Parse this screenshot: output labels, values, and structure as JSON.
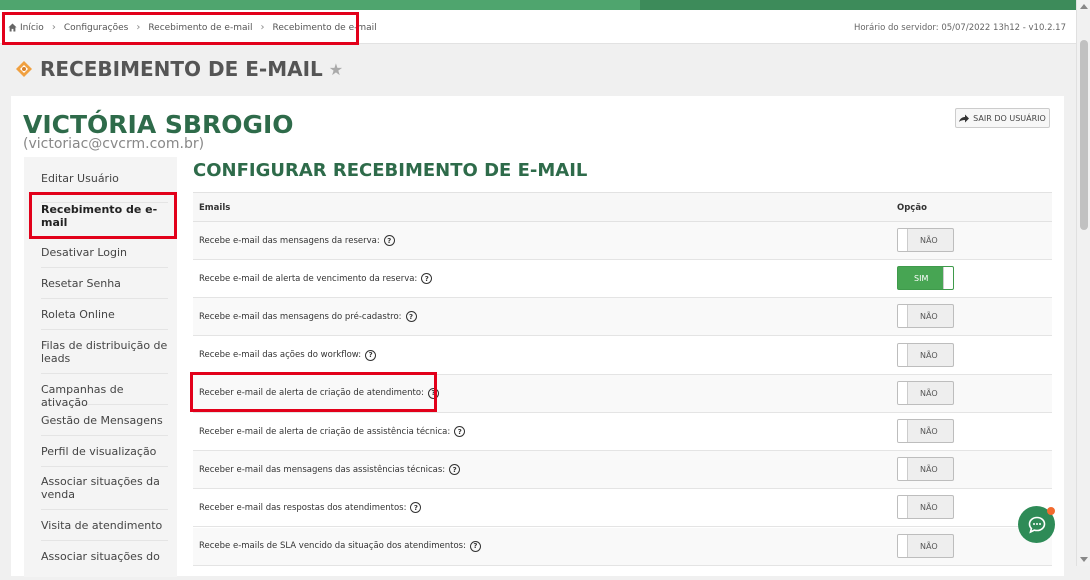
{
  "breadcrumb": [
    "Início",
    "Configurações",
    "Recebimento de e-mail",
    "Recebimento de e-mail"
  ],
  "server_info": "Horário do servidor: 05/07/2022 13h12 - v10.2.17",
  "page_title": "RECEBIMENTO DE E-MAIL",
  "user": {
    "name": "VICTÓRIA SBROGIO",
    "email": "(victoriac@cvcrm.com.br)"
  },
  "logout_label": "SAIR DO USUÁRIO",
  "sidebar": [
    "Editar Usuário",
    "Recebimento de e-mail",
    "Desativar Login",
    "Resetar Senha",
    "Roleta Online",
    "Filas de distribuição de leads",
    "Campanhas de ativação",
    "Gestão de Mensagens",
    "Perfil de visualização",
    "Associar situações da venda",
    "Visita de atendimento",
    "Associar situações do"
  ],
  "sidebar_active_index": 1,
  "section_title": "CONFIGURAR RECEBIMENTO DE E-MAIL",
  "table": {
    "headers": {
      "emails": "Emails",
      "option": "Opção"
    },
    "rows": [
      {
        "label": "Recebe e-mail das mensagens da reserva:",
        "value": "NÃO",
        "on": false
      },
      {
        "label": "Recebe e-mail de alerta de vencimento da reserva:",
        "value": "SIM",
        "on": true
      },
      {
        "label": "Recebe e-mail das mensagens do pré-cadastro:",
        "value": "NÃO",
        "on": false
      },
      {
        "label": "Recebe e-mail das ações do workflow:",
        "value": "NÃO",
        "on": false
      },
      {
        "label": "Receber e-mail de alerta de criação de atendimento:",
        "value": "NÃO",
        "on": false
      },
      {
        "label": "Receber e-mail de alerta de criação de assistência técnica:",
        "value": "NÃO",
        "on": false
      },
      {
        "label": "Receber e-mail das mensagens das assistências técnicas:",
        "value": "NÃO",
        "on": false
      },
      {
        "label": "Receber e-mail das respostas dos atendimentos:",
        "value": "NÃO",
        "on": false
      },
      {
        "label": "Recebe e-mails de SLA vencido da situação dos atendimentos:",
        "value": "NÃO",
        "on": false
      }
    ]
  },
  "help_glyph": "?",
  "colors": {
    "brand_green": "#2e6b4a",
    "toggle_on": "#47a553",
    "highlight": "#e2001a",
    "chat_badge": "#f26a2e"
  },
  "icons": {
    "home": "home-icon",
    "star": "star-icon",
    "logout": "logout-arrow-icon",
    "chat": "chat-icon",
    "help": "help-circle-icon"
  }
}
